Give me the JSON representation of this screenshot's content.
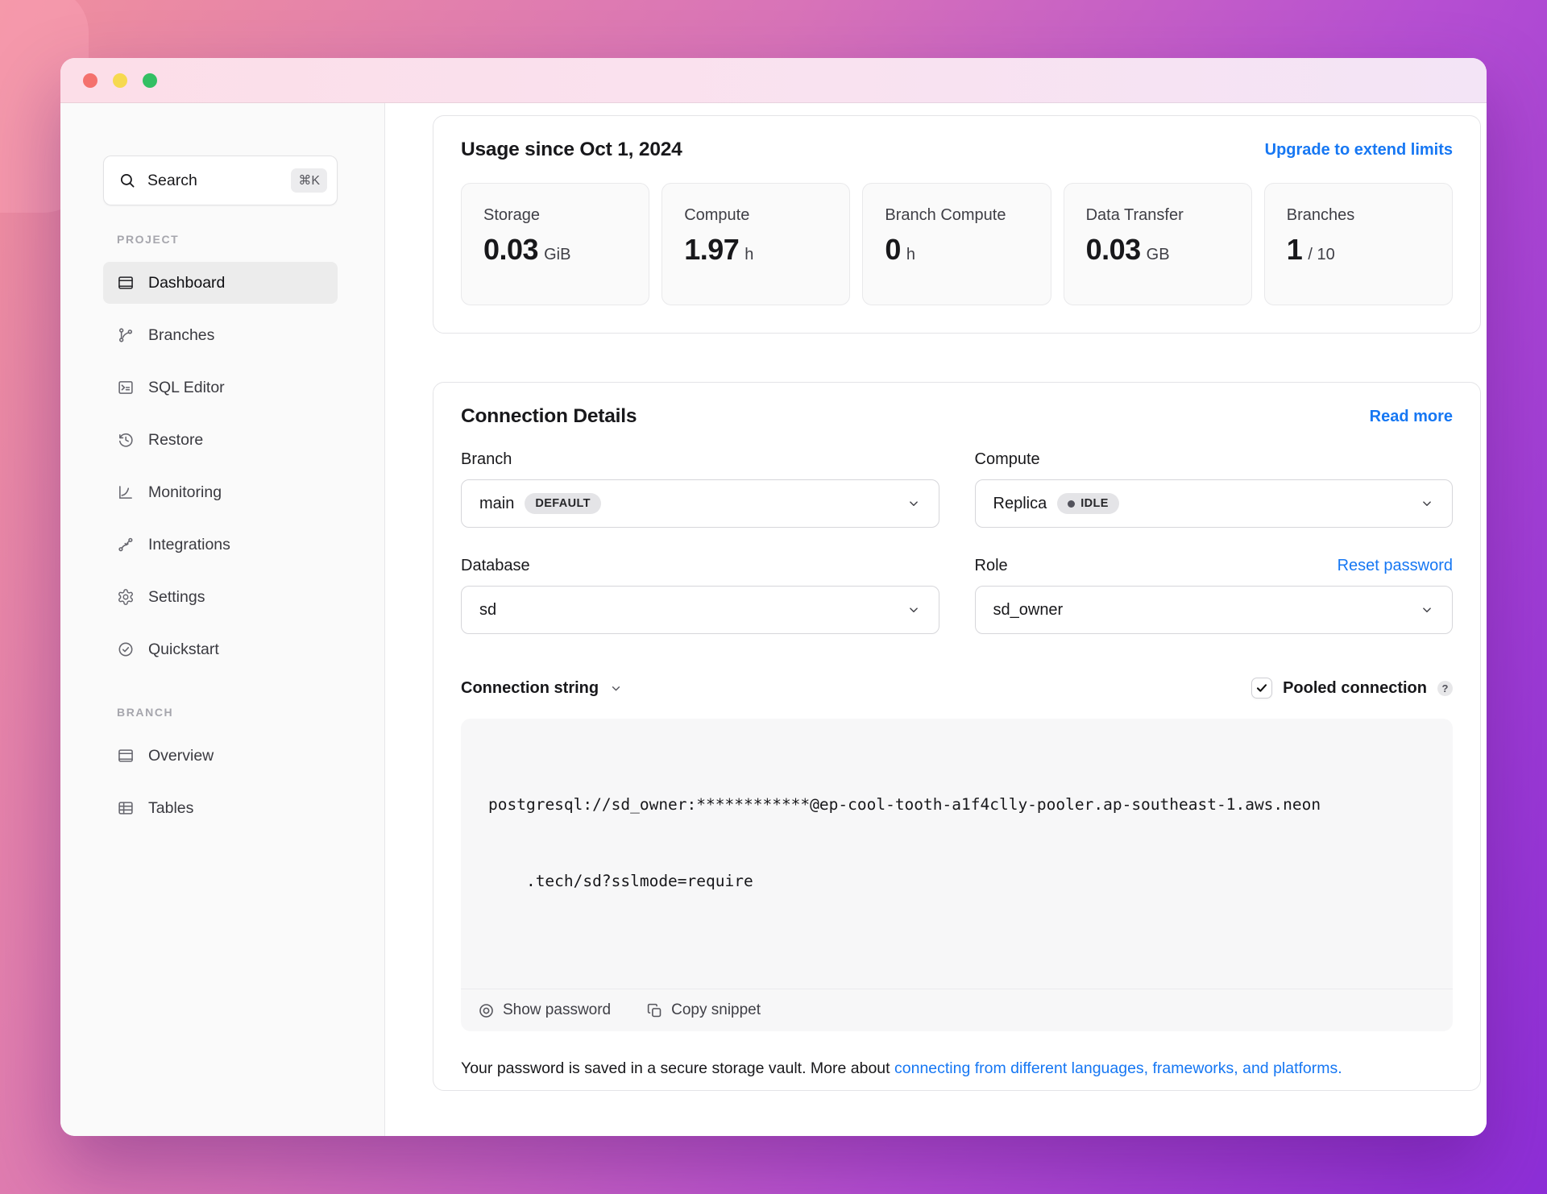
{
  "colors": {
    "accent_blue": "#1677f3",
    "traffic_red": "#f4716d",
    "traffic_yellow": "#f6d94f",
    "traffic_green": "#33bf63",
    "gradient_start": "#f0909e",
    "gradient_end": "#8d2ed7",
    "idle_dot": "#52525b"
  },
  "sidebar": {
    "search": {
      "label": "Search",
      "shortcut": "⌘K"
    },
    "sections": [
      {
        "label": "PROJECT",
        "items": [
          {
            "label": "Dashboard"
          },
          {
            "label": "Branches"
          },
          {
            "label": "SQL Editor"
          },
          {
            "label": "Restore"
          },
          {
            "label": "Monitoring"
          },
          {
            "label": "Integrations"
          },
          {
            "label": "Settings"
          },
          {
            "label": "Quickstart"
          }
        ]
      },
      {
        "label": "BRANCH",
        "items": [
          {
            "label": "Overview"
          },
          {
            "label": "Tables"
          }
        ]
      }
    ]
  },
  "usage": {
    "title": "Usage since Oct 1, 2024",
    "upgrade_link": "Upgrade to extend limits",
    "cards": [
      {
        "label": "Storage",
        "value": "0.03",
        "unit": "GiB"
      },
      {
        "label": "Compute",
        "value": "1.97",
        "unit": "h"
      },
      {
        "label": "Branch Compute",
        "value": "0",
        "unit": "h"
      },
      {
        "label": "Data Transfer",
        "value": "0.03",
        "unit": "GB"
      },
      {
        "label": "Branches",
        "value": "1",
        "unit": "/ 10"
      }
    ]
  },
  "connection": {
    "title": "Connection Details",
    "read_more_link": "Read more",
    "branch": {
      "label": "Branch",
      "value": "main",
      "badge": "DEFAULT"
    },
    "compute": {
      "label": "Compute",
      "value": "Replica",
      "badge": "IDLE"
    },
    "database": {
      "label": "Database",
      "value": "sd"
    },
    "role": {
      "label": "Role",
      "value": "sd_owner",
      "reset_link": "Reset password"
    },
    "string_selector_label": "Connection string",
    "pooled": {
      "label": "Pooled connection",
      "help": "?",
      "checked": true
    },
    "code": {
      "line1": "postgresql://sd_owner:************@ep-cool-tooth-a1f4clly-pooler.ap-southeast-1.aws.neon",
      "line2": ".tech/sd?sslmode=require"
    },
    "show_password_button": "Show password",
    "copy_snippet_button": "Copy snippet",
    "note_text": "Your password is saved in a secure storage vault. More about",
    "note_link": "connecting from different languages, frameworks, and platforms."
  }
}
